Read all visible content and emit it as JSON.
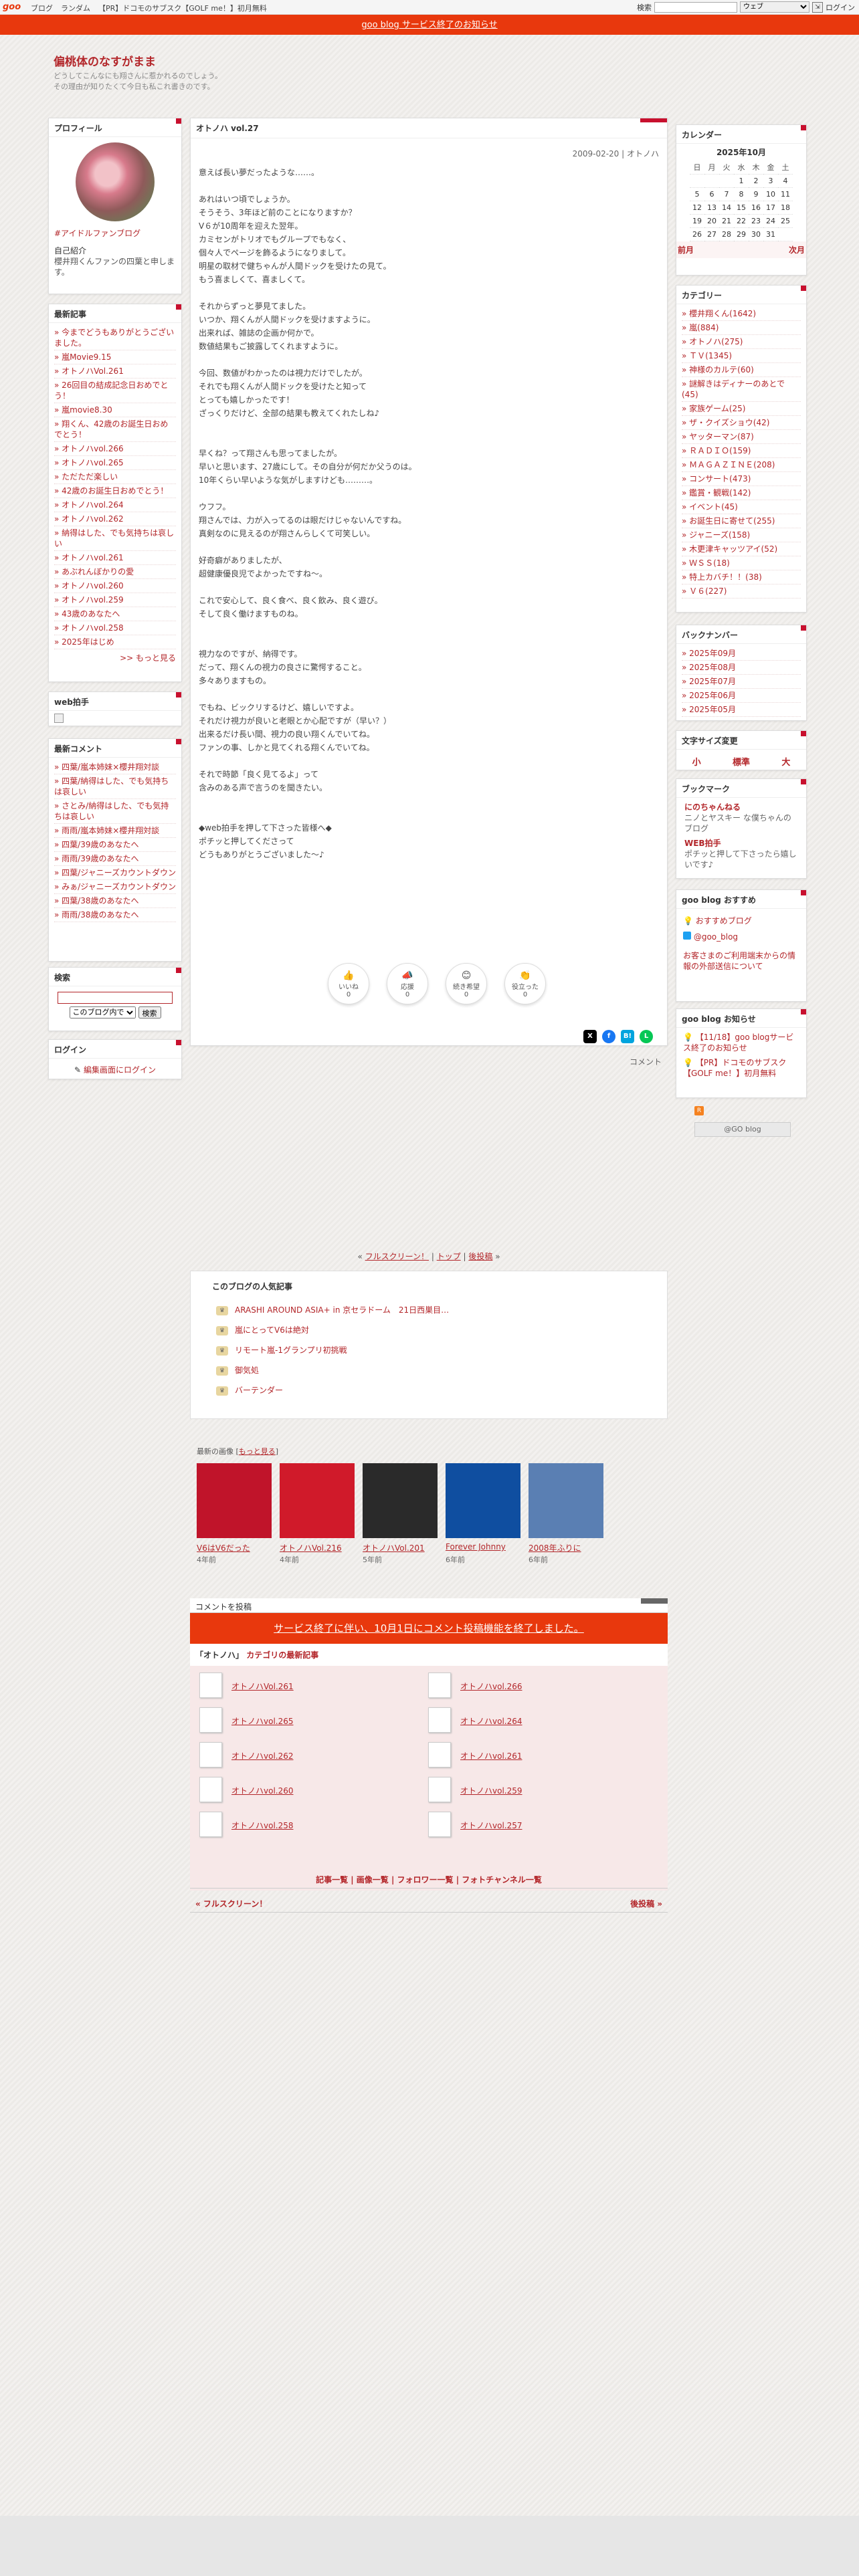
{
  "topbar": {
    "logo": "goo",
    "nav": [
      "ブログ",
      "ランダム",
      "【PR】ドコモのサブスク【GOLF me！】初月無料"
    ],
    "search_label": "検索",
    "search_placeholder": "",
    "search_scope": "ウェブ",
    "login": "ログイン"
  },
  "notice": "goo blog サービス終了のお知らせ",
  "blog": {
    "title": "偏桃体のなすがまま",
    "desc1": "どうしてこんなにも翔さんに惹かれるのでしょう。",
    "desc2": "その理由が知りたくて今日も私これ書きのです。"
  },
  "profile": {
    "heading": "プロフィール",
    "link": "#アイドルファンブログ",
    "intro_label": "自己紹介",
    "intro": "櫻井翔くんファンの四葉と申します。"
  },
  "recent": {
    "heading": "最新記事",
    "items": [
      "今までどうもありがとうございました。",
      "嵐Movie9.15",
      "オトノハVol.261",
      "26回目の結成記念日おめでとう！",
      "嵐movie8.30",
      "翔くん、42歳のお誕生日おめでとう！",
      "オトノハvol.266",
      "オトノハvol.265",
      "ただただ楽しい",
      "42歳のお誕生日おめでとう！",
      "オトノハvol.264",
      "オトノハvol.262",
      "納得はした、でも気持ちは哀しい",
      "オトノハvol.261",
      "あぶれんぼかりの愛",
      "オトノハvol.260",
      "オトノハvol.259",
      "43歳のあなたへ",
      "オトノハvol.258",
      "2025年はじめ"
    ],
    "more": ">> もっと見る"
  },
  "clap": {
    "heading": "web拍手"
  },
  "comments": {
    "heading": "最新コメント",
    "items": [
      "四葉/嵐本姉妹×櫻井翔対談",
      "四葉/納得はした、でも気持ちは哀しい",
      "さとみ/納得はした、でも気持ちは哀しい",
      "雨雨/嵐本姉妹×櫻井翔対談",
      "四葉/39歳のあなたへ",
      "雨雨/39歳のあなたへ",
      "四葉/ジャニーズカウントダウン",
      "みぁ/ジャニーズカウントダウン",
      "四葉/38歳のあなたへ",
      "雨雨/38歳のあなたへ"
    ]
  },
  "search": {
    "heading": "検索",
    "scope": "このブログ内で",
    "button": "検索"
  },
  "login": {
    "heading": "ログイン",
    "link": "編集画面にログイン"
  },
  "article": {
    "title": "オトノハ vol.27",
    "meta": "2009-02-20 | オトノハ",
    "body": "意えば長い夢だったような……。\n\nあれはいつ頃でしょうか。\nそうそう、3年ほど前のことになりますか？\nV６が10周年を迎えた翌年。\nカミセンがトリオでもグループでもなく、\n個々人でページを飾るようになりまして。\n明星の取材で健ちゃんが人間ドックを受けたの見て。\nもう喜ましくて、喜ましくて。\n\nそれからずっと夢見てました。\nいつか、翔くんが人間ドックを受けますように。\n出来れば、雑誌の企画か何かで。\n数値結果もご披露してくれますように。\n\n今回、数値がわかったのは視力だけでしたが。\nそれでも翔くんが人間ドックを受けたと知って\nとっても嬉しかったです！\nざっくりだけど、全部の結果も教えてくれたしね♪\n\n\n早くね？って翔さんも思ってましたが。\n早いと思います、27歳にして。その自分が何だか父うのは。\n10年くらい早いような気がしますけども………。\n\nウフフ。\n翔さんでは、力が入ってるのは眼だけじゃないんですね。\n真剣なのに見えるのが翔さんらしくて可笑しい。\n\n好奇癖がありましたが、\n超健康優良児でよかったですね〜。\n\nこれで安心して、良く食べ、良く飲み、良く遊び。\nそして良く働けますものね。\n\n\n視力なのですが、納得です。\nだって、翔くんの視力の良さに驚愕すること。\n多々ありますもの。\n\nでもね、ビックリするけど、嬉しいですよ。\nそれだけ視力が良いと老眼とか心配ですが（早い？）\n出来るだけ長い間、視力の良い翔くんでいてね。\nファンの事、しかと見てくれる翔くんでいてね。\n\nそれで時節「良く見てるよ」って\n含みのある声で言うのを聞きたい。\n\n\n◆web拍手を押して下さった皆様へ◆\nポチッと押してくださって\nどうもありがとうございました〜♪",
    "category_link": "コメント",
    "reactions": [
      {
        "icon": "👍",
        "label": "いいね",
        "count": "0"
      },
      {
        "icon": "📣",
        "label": "応援",
        "count": "0"
      },
      {
        "icon": "😊",
        "label": "続き希望",
        "count": "0"
      },
      {
        "icon": "👏",
        "label": "役立った",
        "count": "0"
      }
    ],
    "share": [
      "X",
      "f",
      "B!",
      "L"
    ]
  },
  "calendar": {
    "heading": "カレンダー",
    "month": "2025年10月",
    "days": [
      "日",
      "月",
      "火",
      "水",
      "木",
      "金",
      "土"
    ],
    "weeks": [
      [
        "",
        "",
        "",
        "1",
        "2",
        "3",
        "4"
      ],
      [
        "5",
        "6",
        "7",
        "8",
        "9",
        "10",
        "11"
      ],
      [
        "12",
        "13",
        "14",
        "15",
        "16",
        "17",
        "18"
      ],
      [
        "19",
        "20",
        "21",
        "22",
        "23",
        "24",
        "25"
      ],
      [
        "26",
        "27",
        "28",
        "29",
        "30",
        "31",
        ""
      ]
    ],
    "prev": "前月",
    "next": "次月"
  },
  "categories": {
    "heading": "カテゴリー",
    "items": [
      "櫻井翔くん(1642)",
      "嵐(884)",
      "オトノハ(275)",
      "ＴＶ(1345)",
      "神様のカルテ(60)",
      "謎解きはディナーのあとで(45)",
      "家族ゲーム(25)",
      "ザ・クイズショウ(42)",
      "ヤッターマン(87)",
      "ＲＡＤＩＯ(159)",
      "ＭＡＧＡＺＩＮＥ(208)",
      "コンサート(473)",
      "鑑賞・観戦(142)",
      "イベント(45)",
      "お誕生日に寄せて(255)",
      "ジャニーズ(158)",
      "木更津キャッツアイ(52)",
      "ＷＳＳ(18)",
      "特上カバチ！！(38)",
      "Ｖ６(227)"
    ]
  },
  "backnumber": {
    "heading": "バックナンバー",
    "items": [
      "2025年09月",
      "2025年08月",
      "2025年07月",
      "2025年06月",
      "2025年05月"
    ]
  },
  "fontsize": {
    "heading": "文字サイズ変更",
    "small": "小",
    "normal": "標準",
    "large": "大"
  },
  "bookmarks": {
    "heading": "ブックマーク",
    "items": [
      {
        "title": "にのちゃんねる",
        "desc": "ニノとヤスキー な僕ちゃんのブログ"
      },
      {
        "title": "WEB拍手",
        "desc": "ポチッと押して下さったら嬉しいです♪"
      }
    ]
  },
  "goo_recommend": {
    "heading": "goo blog おすすめ",
    "items": [
      "おすすめブログ",
      "@goo_blog"
    ],
    "notice": "お客さまのご利用端末からの情報の外部送信について"
  },
  "goo_notice": {
    "heading": "goo blog お知らせ",
    "items": [
      "【11/18】goo blogサービス終了のお知らせ",
      "【PR】ドコモのサブスク【GOLF me！】初月無料"
    ]
  },
  "gooblog_badge": "@GO blog",
  "pager": {
    "full": "フルスクリーン！",
    "top": "トップ",
    "next": "後投稿"
  },
  "popular": {
    "heading": "このブログの人気記事",
    "items": [
      "ARASHI AROUND ASIA+ in 京セラドーム　21日西巣目…",
      "嵐にとってV6は絶対",
      "リモート嵐-1グランプリ初挑戦",
      "御気処",
      "バーテンダー"
    ]
  },
  "latest_images": {
    "heading": "最新の画像",
    "more": "もっと見る",
    "items": [
      {
        "caption": "V6はV6だった",
        "age": "4年前",
        "color": "#c0142a"
      },
      {
        "caption": "オトノハVol.216",
        "age": "4年前",
        "color": "#d01a2a"
      },
      {
        "caption": "オトノハVol.201",
        "age": "5年前",
        "color": "#2a2a2a"
      },
      {
        "caption": "Forever Johnny",
        "age": "6年前",
        "color": "#0f4ea0"
      },
      {
        "caption": "2008年ふりに",
        "age": "6年前",
        "color": "#5a7fb3"
      }
    ]
  },
  "comment_form": {
    "heading": "コメントを投稿",
    "notice": "サービス終了に伴い、10月1日にコメント投稿機能を終了しました。",
    "cat_heading_pre": "「オトノハ」",
    "cat_heading_post": "カテゴリの最新記事",
    "entries": [
      "オトノハVol.261",
      "オトノハvol.266",
      "オトノハvol.265",
      "オトノハvol.264",
      "オトノハvol.262",
      "オトノハvol.261",
      "オトノハvol.260",
      "オトノハvol.259",
      "オトノハvol.258",
      "オトノハvol.257"
    ]
  },
  "footer_links": "記事一覧 | 画像一覧 | フォロワー一覧 | フォトチャンネル一覧",
  "footer_nav": {
    "prev": "« フルスクリーン！",
    "next": "後投稿 »"
  },
  "colors": {
    "accent": "#b3262a",
    "notice": "#e8380d"
  }
}
